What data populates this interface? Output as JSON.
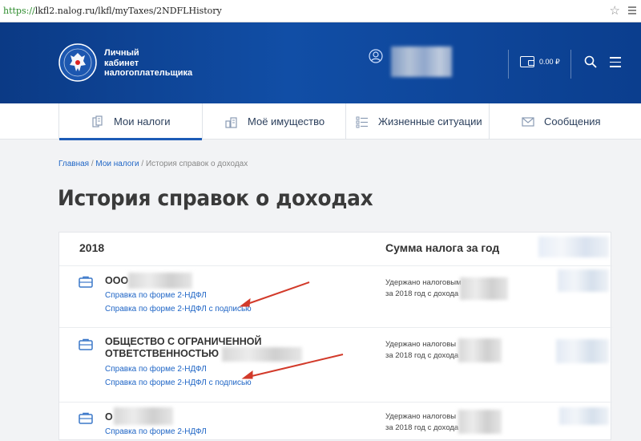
{
  "browser": {
    "url_protocol": "https://",
    "url_rest": "lkfl2.nalog.ru/lkfl/myTaxes/2NDFLHistory"
  },
  "header": {
    "brand_line1": "Личный",
    "brand_line2": "кабинет",
    "brand_line3": "налогоплательщика",
    "balance": "0.00 ₽"
  },
  "nav": {
    "tabs": [
      {
        "label": "Мои налоги"
      },
      {
        "label": "Моё имущество"
      },
      {
        "label": "Жизненные ситуации"
      },
      {
        "label": "Сообщения"
      }
    ]
  },
  "breadcrumbs": {
    "home": "Главная",
    "sep": " / ",
    "taxes": "Мои налоги",
    "current": "История справок о доходах"
  },
  "page": {
    "title": "История справок о доходах"
  },
  "table": {
    "year": "2018",
    "sum_header": "Сумма налога за год",
    "rows": [
      {
        "org_line1": "ООО",
        "org_line2": "",
        "link1": "Справка по форме 2-НДФЛ",
        "link2": "Справка по форме 2-НДФЛ с подписью",
        "withheld_line1": "Удержано налоговым агентом",
        "withheld_line2": "за 2018 год с дохода"
      },
      {
        "org_line1": "ОБЩЕСТВО С ОГРАНИЧЕННОЙ",
        "org_line2": "ОТВЕТСТВЕННОСТЬЮ",
        "link1": "Справка по форме 2-НДФЛ",
        "link2": "Справка по форме 2-НДФЛ с подписью",
        "withheld_line1": "Удержано налоговы",
        "withheld_line2": "за 2018 год с дохода"
      },
      {
        "org_line1": "О",
        "org_line2": "",
        "link1": "Справка по форме 2-НДФЛ",
        "link2": "",
        "withheld_line1": "Удержано налоговы",
        "withheld_line2": "за 2018 год с дохода"
      }
    ]
  },
  "colors": {
    "header_blue": "#114ea6",
    "link_blue": "#2066c6",
    "annotation_red": "#d23a2a"
  }
}
